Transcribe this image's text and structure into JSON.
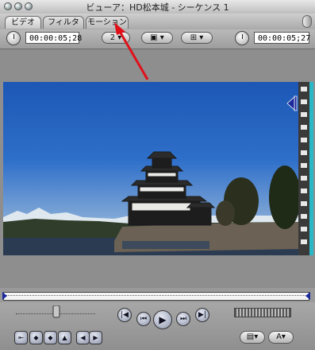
{
  "window": {
    "title": "ビューア：HD松本城 - シーケンス 1"
  },
  "tabs": [
    {
      "label": "ビデオ"
    },
    {
      "label": "フィルタ"
    },
    {
      "label": "モーション"
    }
  ],
  "toolbar": {
    "duration_timecode": "00:00:05;28",
    "zoom_value": "2",
    "current_timecode": "00:00:05;27"
  },
  "colors": {
    "annotation_arrow": "#e0101a",
    "in_out_strip": "#28b8c8"
  }
}
